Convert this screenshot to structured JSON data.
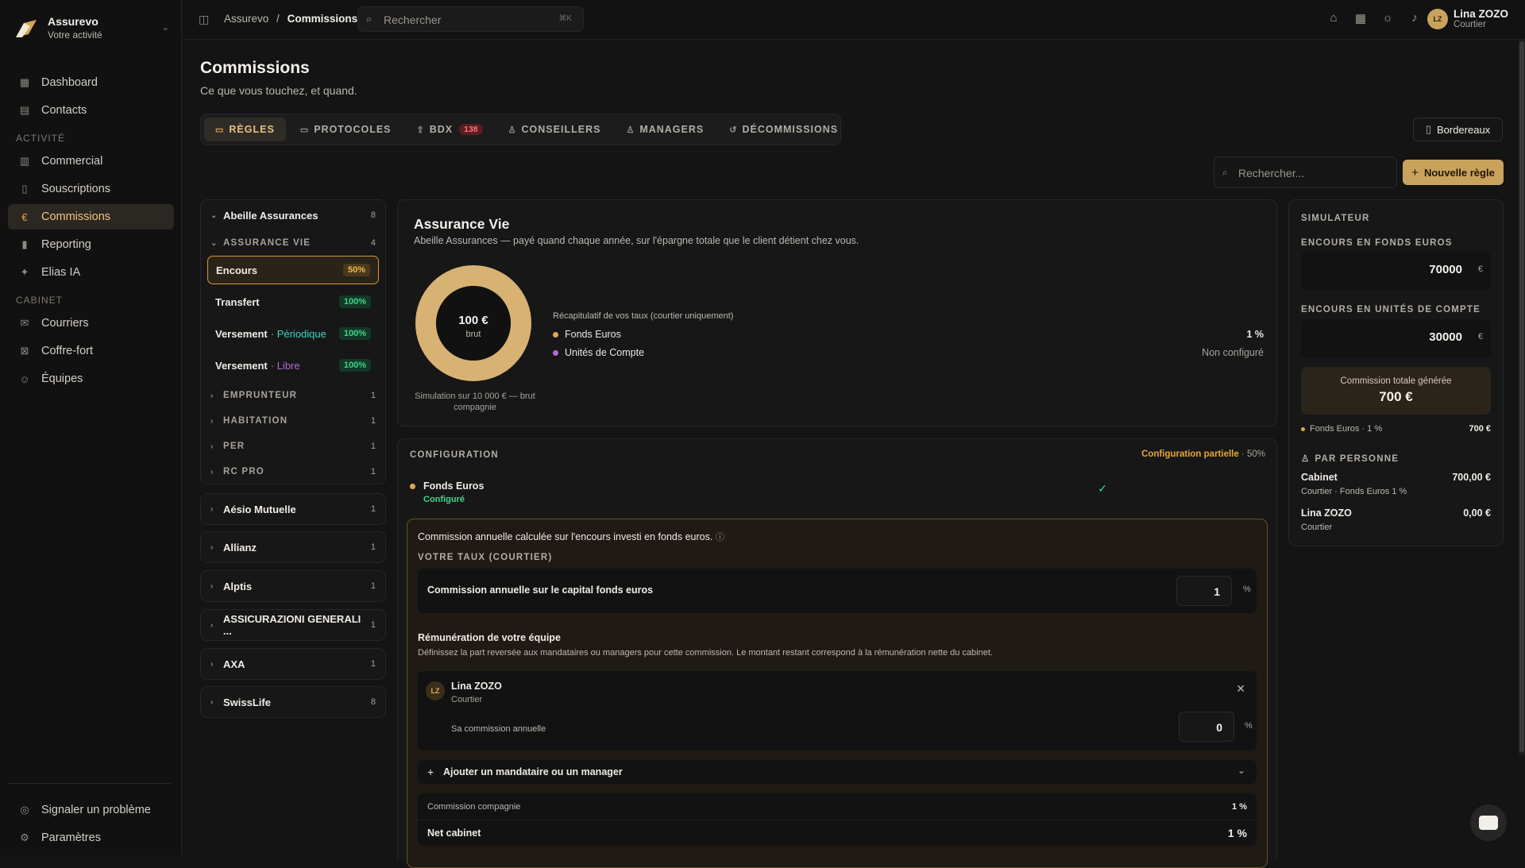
{
  "app": {
    "name": "Assurevo",
    "subtitle": "Votre activité"
  },
  "sidebar": {
    "top": [
      {
        "label": "Dashboard",
        "icon": "dashboard-icon"
      },
      {
        "label": "Contacts",
        "icon": "contacts-icon"
      }
    ],
    "section_activity": "ACTIVITÉ",
    "activity": [
      {
        "label": "Commercial",
        "icon": "building-icon"
      },
      {
        "label": "Souscriptions",
        "icon": "document-icon"
      },
      {
        "label": "Commissions",
        "icon": "euro-icon"
      },
      {
        "label": "Reporting",
        "icon": "chart-icon"
      },
      {
        "label": "Elias IA",
        "icon": "sparkle-icon"
      }
    ],
    "section_cabinet": "CABINET",
    "cabinet": [
      {
        "label": "Courriers",
        "icon": "mail-icon"
      },
      {
        "label": "Coffre-fort",
        "icon": "vault-icon"
      },
      {
        "label": "Équipes",
        "icon": "team-icon"
      }
    ],
    "bottom": [
      {
        "label": "Signaler un problème",
        "icon": "bug-icon"
      },
      {
        "label": "Paramètres",
        "icon": "gear-icon"
      }
    ]
  },
  "topbar": {
    "breadcrumb_root": "Assurevo",
    "breadcrumb_sep": "/",
    "breadcrumb_current": "Commissions",
    "search_placeholder": "Rechercher",
    "search_shortcut": "⌘K",
    "user_name": "Lina ZOZO",
    "user_role": "Courtier",
    "user_initials": "LZ"
  },
  "page": {
    "title": "Commissions",
    "subtitle": "Ce que vous touchez, et quand.",
    "tabs": [
      {
        "label": "RÈGLES",
        "icon": "book-icon"
      },
      {
        "label": "PROTOCOLES",
        "icon": "folder-icon"
      },
      {
        "label": "BDX",
        "icon": "upload-icon",
        "badge": "138"
      },
      {
        "label": "CONSEILLERS",
        "icon": "person-icon"
      },
      {
        "label": "MANAGERS",
        "icon": "people-icon"
      },
      {
        "label": "DÉCOMMISSIONS",
        "icon": "undo-icon"
      }
    ],
    "bordereaux_button": "Bordereaux",
    "search_placeholder": "Rechercher...",
    "new_rule_button": "Nouvelle règle"
  },
  "insurers": {
    "expanded": {
      "name": "Abeille Assurances",
      "count": "8"
    },
    "expanded_group": {
      "name": "ASSURANCE VIE",
      "count": "4"
    },
    "rules": [
      {
        "name": "Encours",
        "accent": "",
        "pct": "50%"
      },
      {
        "name": "Transfert",
        "accent": "",
        "pct": "100%"
      },
      {
        "name": "Versement",
        "accent": " · Périodique",
        "pct": "100%"
      },
      {
        "name": "Versement",
        "accent": " · Libre",
        "pct": "100%"
      }
    ],
    "groups": [
      {
        "name": "EMPRUNTEUR",
        "count": "1"
      },
      {
        "name": "HABITATION",
        "count": "1"
      },
      {
        "name": "PER",
        "count": "1"
      },
      {
        "name": "RC PRO",
        "count": "1"
      }
    ],
    "others": [
      {
        "name": "Aésio Mutuelle",
        "count": "1"
      },
      {
        "name": "Allianz",
        "count": "1"
      },
      {
        "name": "Alptis",
        "count": "1"
      },
      {
        "name": "ASSICURAZIONI GENERALI ...",
        "count": "1"
      },
      {
        "name": "AXA",
        "count": "1"
      },
      {
        "name": "SwissLife",
        "count": "8"
      }
    ]
  },
  "rule_card": {
    "title": "Assurance Vie",
    "description": "Abeille Assurances — payé quand chaque année, sur l'épargne totale que le client détient chez vous.",
    "donut_value": "100 €",
    "donut_label": "brut",
    "donut_caption": "Simulation sur 10 000 € — brut compagnie",
    "donut_fill_fraction": 1.0,
    "donut_color": "#d7b273",
    "recap_title": "Récapitulatif de vos taux (courtier uniquement)",
    "recap": [
      {
        "label": "Fonds Euros",
        "value": "1 %",
        "color": "#e0a94f"
      },
      {
        "label": "Unités de Compte",
        "value": "Non configuré",
        "color": "#b36ad6"
      }
    ]
  },
  "configuration": {
    "title": "CONFIGURATION",
    "status": "Configuration partielle",
    "status_pct": " · 50%",
    "fund_name": "Fonds Euros",
    "fund_state": "Configuré",
    "calc_text": "Commission annuelle calculée sur l'encours investi en fonds euros.",
    "rate_section": "VOTRE TAUX (COURTIER)",
    "rate_label": "Commission annuelle sur le capital fonds euros",
    "rate_value": "1",
    "pct_sign": "%",
    "team_title": "Rémunération de votre équipe",
    "team_desc": "Définissez la part reversée aux mandataires ou managers pour cette commission. Le montant restant correspond à la rémunération nette du cabinet.",
    "member_initials": "LZ",
    "member_name": "Lina ZOZO",
    "member_role": "Courtier",
    "member_comm_label": "Sa commission annuelle",
    "member_comm_value": "0",
    "add_member": "Ajouter un mandataire ou un manager",
    "company_comm_label": "Commission compagnie",
    "company_comm_value": "1 %",
    "net_label": "Net cabinet",
    "net_value": "1 %"
  },
  "simulator": {
    "title": "SIMULATEUR",
    "fonds_label": "ENCOURS EN FONDS EUROS",
    "fonds_value": "70000",
    "uc_label": "ENCOURS EN UNITÉS DE COMPTE",
    "uc_value": "30000",
    "unit": "€",
    "total_label": "Commission totale générée",
    "total_value": "700 €",
    "breakdown_label": "Fonds Euros · 1 %",
    "breakdown_value": "700 €",
    "per_person_title": "PAR PERSONNE",
    "persons": [
      {
        "name": "Cabinet",
        "detail": "Courtier · Fonds Euros 1 %",
        "value": "700,00 €"
      },
      {
        "name": "Lina ZOZO",
        "detail": "Courtier",
        "value": "0,00 €"
      }
    ]
  },
  "colors": {
    "accent": "#c9a25c",
    "positive": "#3ed68a",
    "warning": "#e8a831",
    "danger": "#ff6f76"
  }
}
